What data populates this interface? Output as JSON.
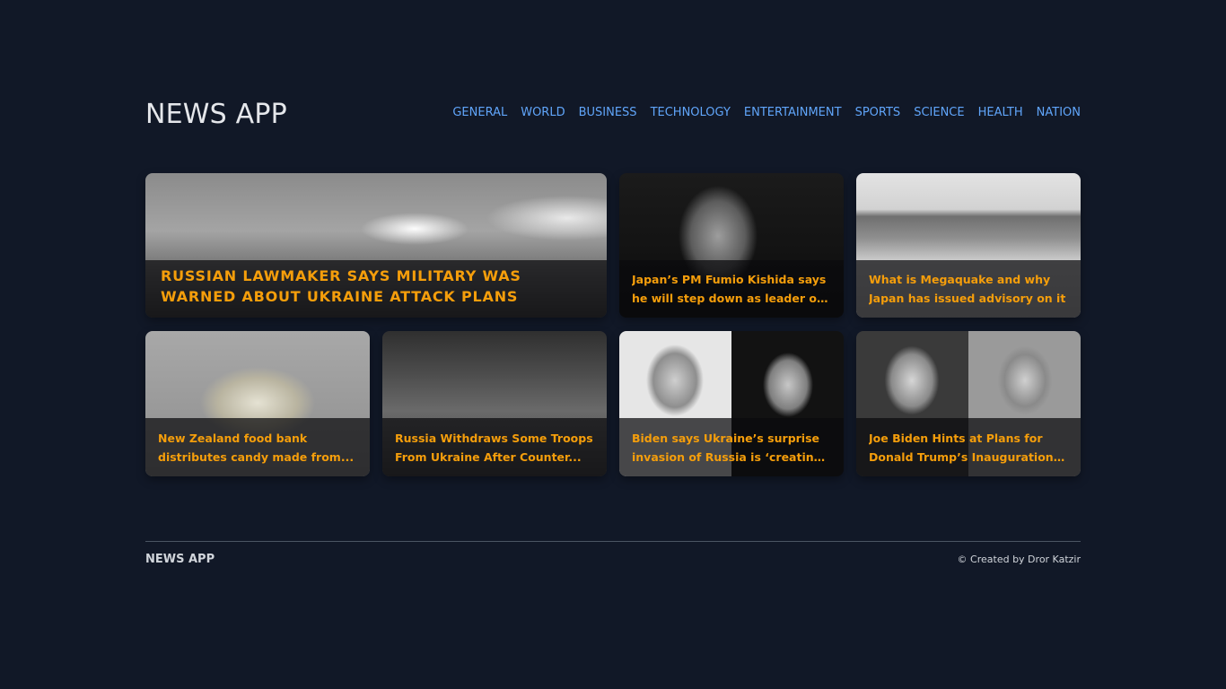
{
  "header": {
    "logo": "NEWS APP",
    "nav": [
      {
        "label": "GENERAL"
      },
      {
        "label": "WORLD"
      },
      {
        "label": "BUSINESS"
      },
      {
        "label": "TECHNOLOGY"
      },
      {
        "label": "ENTERTAINMENT"
      },
      {
        "label": "SPORTS"
      },
      {
        "label": "SCIENCE"
      },
      {
        "label": "HEALTH"
      },
      {
        "label": "NATION"
      }
    ]
  },
  "articles": [
    {
      "title": "RUSSIAN LAWMAKER SAYS MILITARY WAS WARNED ABOUT UKRAINE ATTACK PLANS"
    },
    {
      "title": "Japan’s PM Fumio Kishida says he will step down as leader of LDP..."
    },
    {
      "title": "What is Megaquake and why Japan has issued advisory on it"
    },
    {
      "title": "New Zealand food bank distributes candy made from..."
    },
    {
      "title": "Russia Withdraws Some Troops From Ukraine After Counter..."
    },
    {
      "title": "Biden says Ukraine’s surprise invasion of Russia is ‘creating a..."
    },
    {
      "title": "Joe Biden Hints at Plans for Donald Trump’s Inauguration if..."
    }
  ],
  "footer": {
    "brand": "NEWS APP",
    "credit": "© Created by Dror Katzir"
  }
}
